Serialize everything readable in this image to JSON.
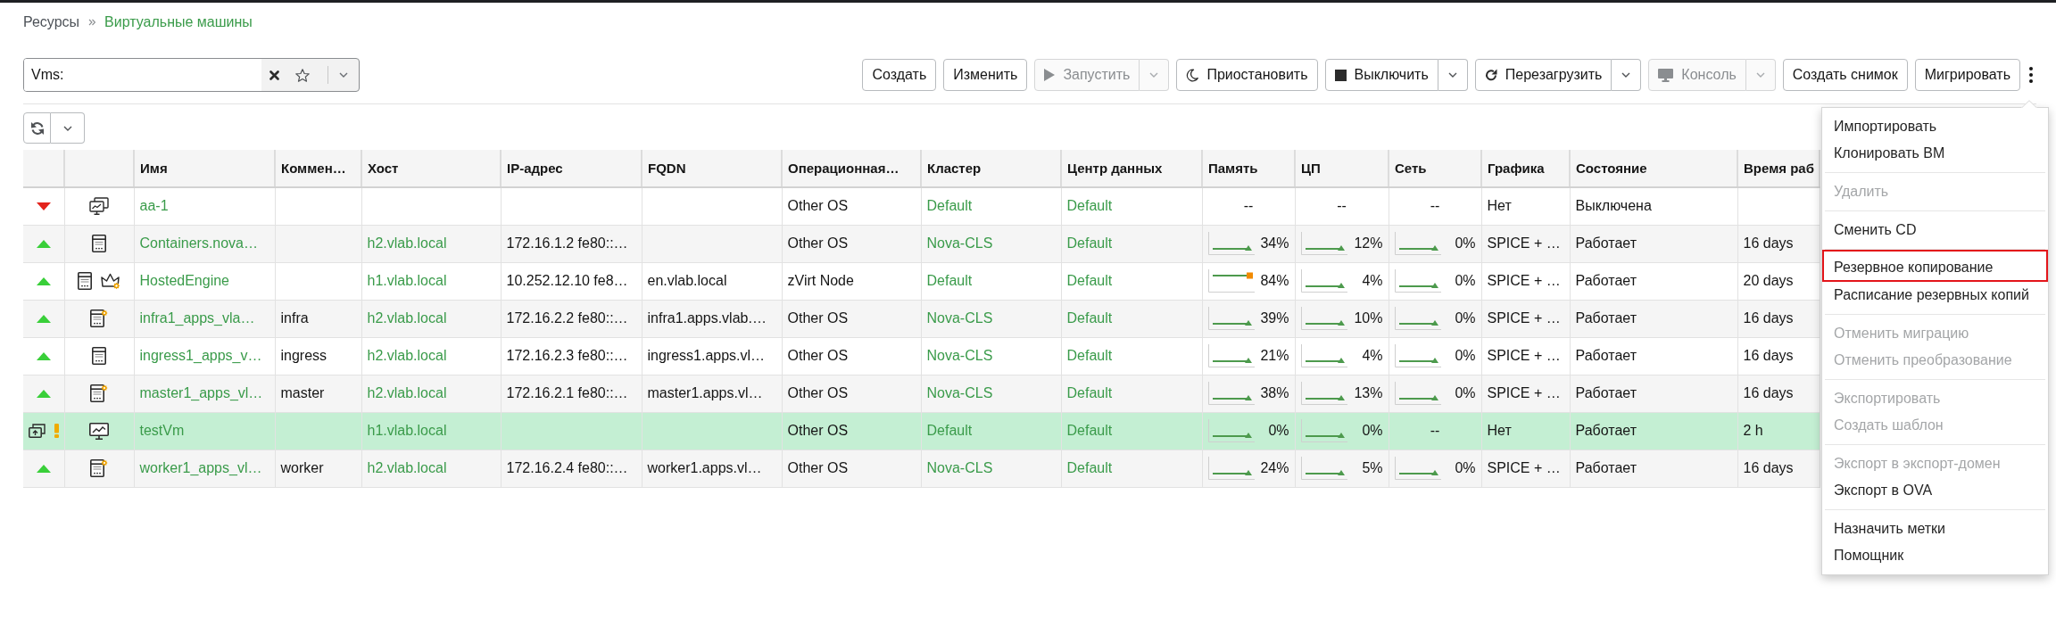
{
  "breadcrumb": [
    {
      "label": "Ресурсы",
      "current": false
    },
    {
      "label": "Виртуальные машины",
      "current": true
    }
  ],
  "search": {
    "prefix": "Vms:"
  },
  "toolbar": {
    "buttons": [
      {
        "label": "Создать",
        "kind": "plain",
        "disabled": false
      },
      {
        "label": "Изменить",
        "kind": "plain",
        "disabled": false
      },
      {
        "label": "Запустить",
        "kind": "split",
        "disabled": true
      },
      {
        "label": "Приостановить",
        "kind": "plain",
        "disabled": false
      },
      {
        "label": "Выключить",
        "kind": "split",
        "disabled": false
      },
      {
        "label": "Перезагрузить",
        "kind": "split",
        "disabled": false
      },
      {
        "label": "Консоль",
        "kind": "split",
        "disabled": true
      },
      {
        "label": "Создать снимок",
        "kind": "plain",
        "disabled": false
      },
      {
        "label": "Мигрировать",
        "kind": "plain",
        "disabled": false
      }
    ],
    "more_menu": {
      "groups": [
        {
          "items": [
            {
              "label": "Импортировать",
              "disabled": false,
              "highlighted": false
            },
            {
              "label": "Клонировать ВМ",
              "disabled": false,
              "highlighted": false
            }
          ]
        },
        {
          "items": [
            {
              "label": "Удалить",
              "disabled": true,
              "highlighted": false
            }
          ]
        },
        {
          "items": [
            {
              "label": "Сменить CD",
              "disabled": false,
              "highlighted": false
            }
          ]
        },
        {
          "items": [
            {
              "label": "Резервное копирование",
              "disabled": false,
              "highlighted": true
            },
            {
              "label": "Расписание резервных копий",
              "disabled": false,
              "highlighted": false
            }
          ]
        },
        {
          "items": [
            {
              "label": "Отменить миграцию",
              "disabled": true,
              "highlighted": false
            },
            {
              "label": "Отменить преобразование",
              "disabled": true,
              "highlighted": false
            }
          ]
        },
        {
          "items": [
            {
              "label": "Экспортировать",
              "disabled": true,
              "highlighted": false
            },
            {
              "label": "Создать шаблон",
              "disabled": true,
              "highlighted": false
            }
          ]
        },
        {
          "items": [
            {
              "label": "Экспорт в экспорт-домен",
              "disabled": true,
              "highlighted": false
            },
            {
              "label": "Экспорт в OVA",
              "disabled": false,
              "highlighted": false
            }
          ]
        },
        {
          "items": [
            {
              "label": "Назначить метки",
              "disabled": false,
              "highlighted": false
            },
            {
              "label": "Помощник",
              "disabled": false,
              "highlighted": false
            }
          ]
        }
      ]
    }
  },
  "table": {
    "columns": [
      "Имя",
      "Коммен…",
      "Хост",
      "IP-адрес",
      "FQDN",
      "Операционная…",
      "Кластер",
      "Центр данных",
      "Память",
      "ЦП",
      "Сеть",
      "Графика",
      "Состояние",
      "Время раб"
    ],
    "rows": [
      {
        "status_icons": [
          {
            "kind": "down"
          }
        ],
        "type_icons": [
          {
            "kind": "desktop-pool"
          }
        ],
        "name": "aa-1",
        "os": "Other OS",
        "cluster": "Default",
        "data_center": "Default",
        "memory": {
          "kind": "none",
          "reading": "--"
        },
        "cpu": {
          "kind": "none",
          "reading": "--"
        },
        "network": {
          "kind": "none",
          "reading": "--"
        },
        "graphics": "Нет",
        "state": "Выключена",
        "selected": false
      },
      {
        "status_icons": [
          {
            "kind": "up"
          }
        ],
        "type_icons": [
          {
            "kind": "server"
          }
        ],
        "name": "Containers.nova…",
        "host": "h2.vlab.local",
        "ip": "172.16.1.2 fe80::…",
        "os": "Other OS",
        "cluster": "Nova-CLS",
        "data_center": "Default",
        "memory": {
          "kind": "sparkline",
          "reading": "34%",
          "alert": false
        },
        "cpu": {
          "kind": "sparkline",
          "reading": "12%",
          "alert": false
        },
        "network": {
          "kind": "sparkline",
          "reading": "0%",
          "alert": false
        },
        "graphics": "SPICE + …",
        "state": "Работает",
        "uptime": "16 days",
        "selected": false
      },
      {
        "status_icons": [
          {
            "kind": "up"
          }
        ],
        "type_icons": [
          {
            "kind": "server"
          },
          {
            "kind": "hosted-engine"
          }
        ],
        "name": "HostedEngine",
        "host": "h1.vlab.local",
        "ip": "10.252.12.10 fe8…",
        "fqdn": "en.vlab.local",
        "os": "zVirt Node",
        "cluster": "Default",
        "data_center": "Default",
        "memory": {
          "kind": "sparkline",
          "reading": "84%",
          "alert": true
        },
        "cpu": {
          "kind": "sparkline",
          "reading": "4%",
          "alert": false
        },
        "network": {
          "kind": "sparkline",
          "reading": "0%",
          "alert": false
        },
        "graphics": "SPICE + …",
        "state": "Работает",
        "uptime": "20 days",
        "selected": false
      },
      {
        "status_icons": [
          {
            "kind": "up"
          }
        ],
        "type_icons": [
          {
            "kind": "high-performance"
          }
        ],
        "name": "infra1_apps_vla…",
        "comment": "infra",
        "host": "h2.vlab.local",
        "ip": "172.16.2.2 fe80::…",
        "fqdn": "infra1.apps.vlab.…",
        "os": "Other OS",
        "cluster": "Nova-CLS",
        "data_center": "Default",
        "memory": {
          "kind": "sparkline",
          "reading": "39%",
          "alert": false
        },
        "cpu": {
          "kind": "sparkline",
          "reading": "10%",
          "alert": false
        },
        "network": {
          "kind": "sparkline",
          "reading": "0%",
          "alert": false
        },
        "graphics": "SPICE + …",
        "state": "Работает",
        "uptime": "16 days",
        "selected": false
      },
      {
        "status_icons": [
          {
            "kind": "up"
          }
        ],
        "type_icons": [
          {
            "kind": "server"
          }
        ],
        "name": "ingress1_apps_v…",
        "comment": "ingress",
        "host": "h2.vlab.local",
        "ip": "172.16.2.3 fe80::…",
        "fqdn": "ingress1.apps.vl…",
        "os": "Other OS",
        "cluster": "Nova-CLS",
        "data_center": "Default",
        "memory": {
          "kind": "sparkline",
          "reading": "21%",
          "alert": false
        },
        "cpu": {
          "kind": "sparkline",
          "reading": "4%",
          "alert": false
        },
        "network": {
          "kind": "sparkline",
          "reading": "0%",
          "alert": false
        },
        "graphics": "SPICE + …",
        "state": "Работает",
        "uptime": "16 days",
        "selected": false
      },
      {
        "status_icons": [
          {
            "kind": "up"
          }
        ],
        "type_icons": [
          {
            "kind": "high-performance"
          }
        ],
        "name": "master1_apps_vl…",
        "comment": "master",
        "host": "h2.vlab.local",
        "ip": "172.16.2.1 fe80::…",
        "fqdn": "master1.apps.vl…",
        "os": "Other OS",
        "cluster": "Nova-CLS",
        "data_center": "Default",
        "memory": {
          "kind": "sparkline",
          "reading": "38%",
          "alert": false
        },
        "cpu": {
          "kind": "sparkline",
          "reading": "13%",
          "alert": false
        },
        "network": {
          "kind": "sparkline",
          "reading": "0%",
          "alert": false
        },
        "graphics": "SPICE + …",
        "state": "Работает",
        "uptime": "16 days",
        "selected": false
      },
      {
        "status_icons": [
          {
            "kind": "changes-pending"
          },
          {
            "kind": "warning"
          }
        ],
        "type_icons": [
          {
            "kind": "desktop"
          }
        ],
        "name": "testVm",
        "host": "h1.vlab.local",
        "os": "Other OS",
        "cluster": "Default",
        "data_center": "Default",
        "memory": {
          "kind": "sparkline",
          "reading": "0%",
          "alert": false
        },
        "cpu": {
          "kind": "sparkline",
          "reading": "0%",
          "alert": false
        },
        "network": {
          "kind": "none",
          "reading": "--"
        },
        "graphics": "Нет",
        "state": "Работает",
        "uptime": "2 h",
        "selected": true
      },
      {
        "status_icons": [
          {
            "kind": "up"
          }
        ],
        "type_icons": [
          {
            "kind": "high-performance"
          }
        ],
        "name": "worker1_apps_vl…",
        "comment": "worker",
        "host": "h2.vlab.local",
        "ip": "172.16.2.4 fe80::…",
        "fqdn": "worker1.apps.vl…",
        "os": "Other OS",
        "cluster": "Nova-CLS",
        "data_center": "Default",
        "memory": {
          "kind": "sparkline",
          "reading": "24%",
          "alert": false
        },
        "cpu": {
          "kind": "sparkline",
          "reading": "5%",
          "alert": false
        },
        "network": {
          "kind": "sparkline",
          "reading": "0%",
          "alert": false
        },
        "graphics": "SPICE + …",
        "state": "Работает",
        "uptime": "16 days",
        "selected": false
      }
    ]
  }
}
